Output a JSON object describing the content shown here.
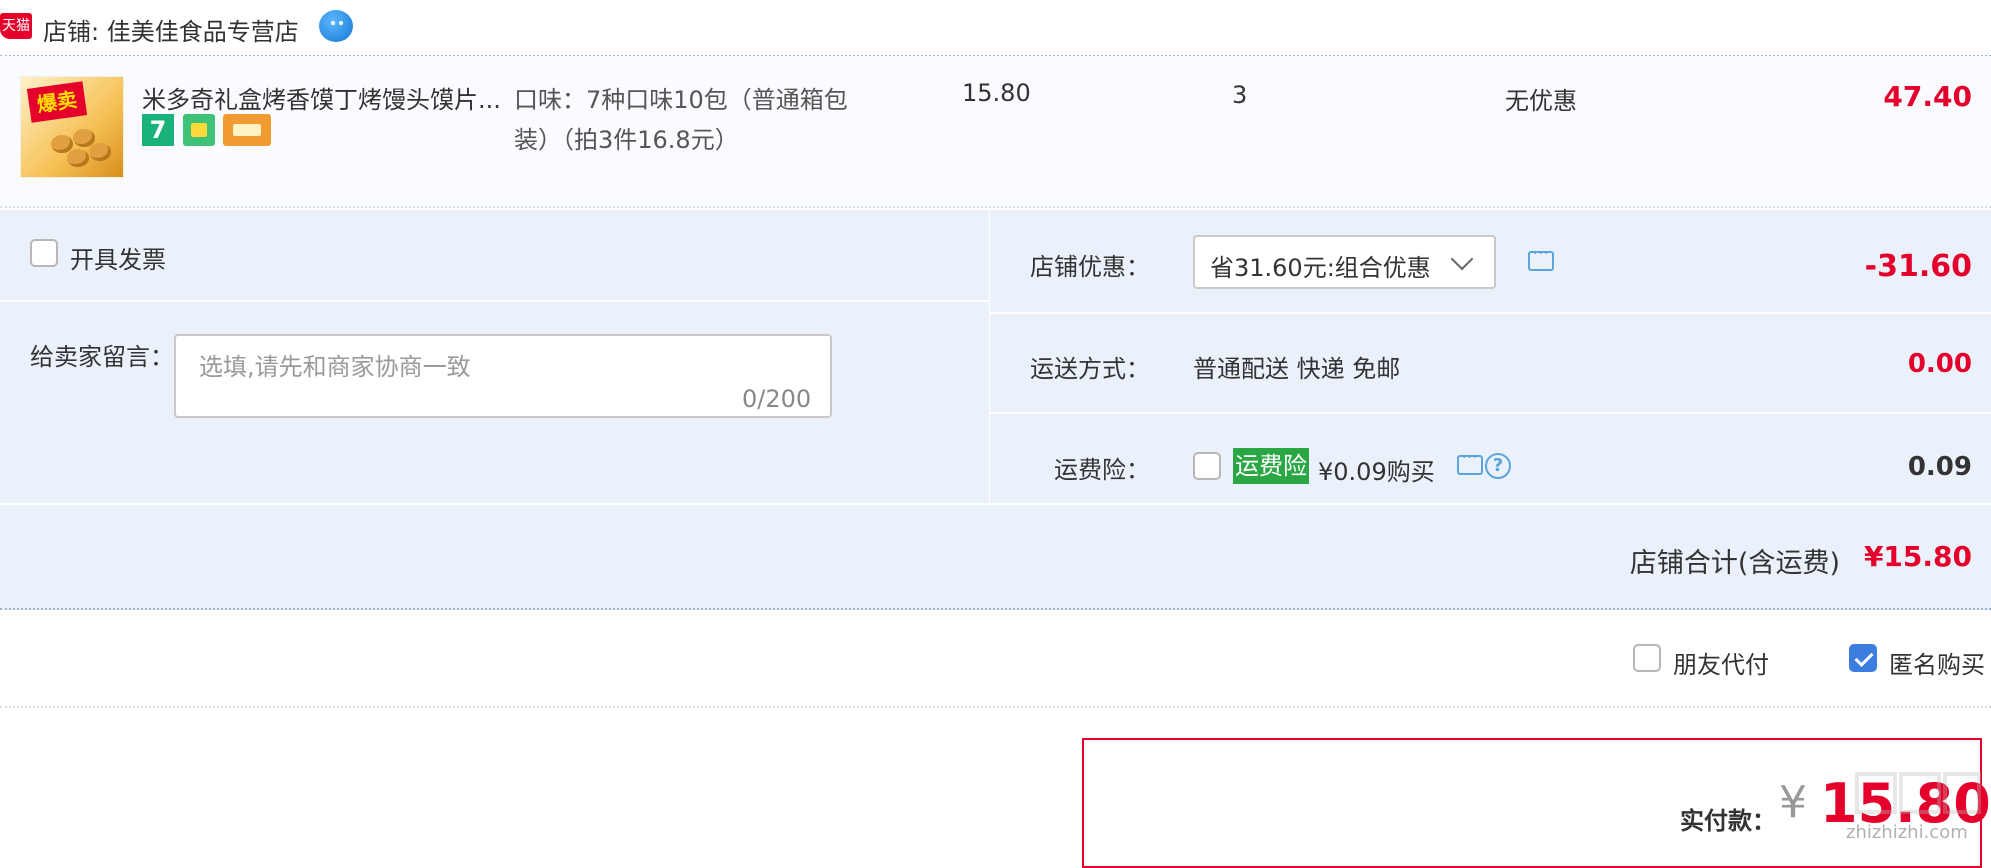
{
  "shop": {
    "platform_badge": "天猫",
    "label": "店铺: 佳美佳食品专营店"
  },
  "item": {
    "title": "米多奇礼盒烤香馍丁烤馒头馍片...",
    "thumb_text": "爆卖",
    "service_badge": "7",
    "spec": "口味：7种口味10包（普通箱包装）（拍3件16.8元）",
    "price": "15.80",
    "quantity": "3",
    "discount": "无优惠",
    "subtotal": "47.40"
  },
  "options": {
    "invoice_label": "开具发票",
    "message_label": "给卖家留言：",
    "message_placeholder": "选填,请先和商家协商一致",
    "message_count": "0/200",
    "promo_label": "店铺优惠：",
    "promo_selected": "省31.60元:组合优惠",
    "promo_amount": "-31.60",
    "shipping_label": "运送方式：",
    "shipping_value": "普通配送 快递 免邮",
    "shipping_amount": "0.00",
    "insurance_label": "运费险：",
    "insurance_badge": "运费险",
    "insurance_price": "¥0.09购买",
    "insurance_amount": "0.09",
    "total_label": "店铺合计(含运费)",
    "total_amount": "¥15.80"
  },
  "payment_options": {
    "friend_pay_label": "朋友代付",
    "anonymous_label": "匿名购买",
    "anonymous_checked": true
  },
  "payment": {
    "label": "实付款：",
    "currency": "¥",
    "amount": "15.80"
  },
  "watermark": {
    "text": "zhizhizhi.com"
  },
  "colors": {
    "price_red": "#e4002b",
    "panel_blue": "#eaf1fb",
    "insurance_green": "#2aa744",
    "checkbox_blue": "#3b7ee0"
  }
}
